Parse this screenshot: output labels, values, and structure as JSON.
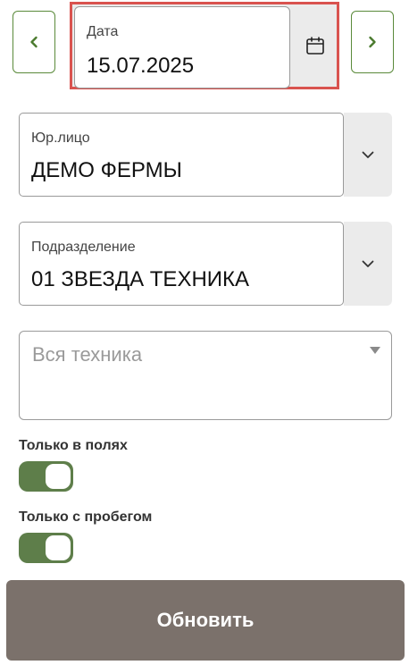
{
  "date": {
    "label": "Дата",
    "value": "15.07.2025",
    "prev_icon": "chevron-left-icon",
    "next_icon": "chevron-right-icon",
    "calendar_icon": "calendar-icon",
    "highlight_color": "#d9534f"
  },
  "legal_entity": {
    "label": "Юр.лицо",
    "value": "ДЕМО ФЕРМЫ",
    "icon": "chevron-down-icon"
  },
  "division": {
    "label": "Подразделение",
    "value": "01 ЗВЕЗДА ТЕХНИКА",
    "icon": "chevron-down-icon"
  },
  "equipment": {
    "placeholder": "Вся техника",
    "icon": "caret-down-icon"
  },
  "toggles": {
    "only_in_fields": {
      "label": "Только в полях",
      "checked": true
    },
    "only_with_mileage": {
      "label": "Только с пробегом",
      "checked": true
    }
  },
  "refresh": {
    "label": "Обновить"
  },
  "colors": {
    "accent_green": "#5a8a3a",
    "toggle_on": "#5e7e4a",
    "button_bg": "#7b716b"
  }
}
